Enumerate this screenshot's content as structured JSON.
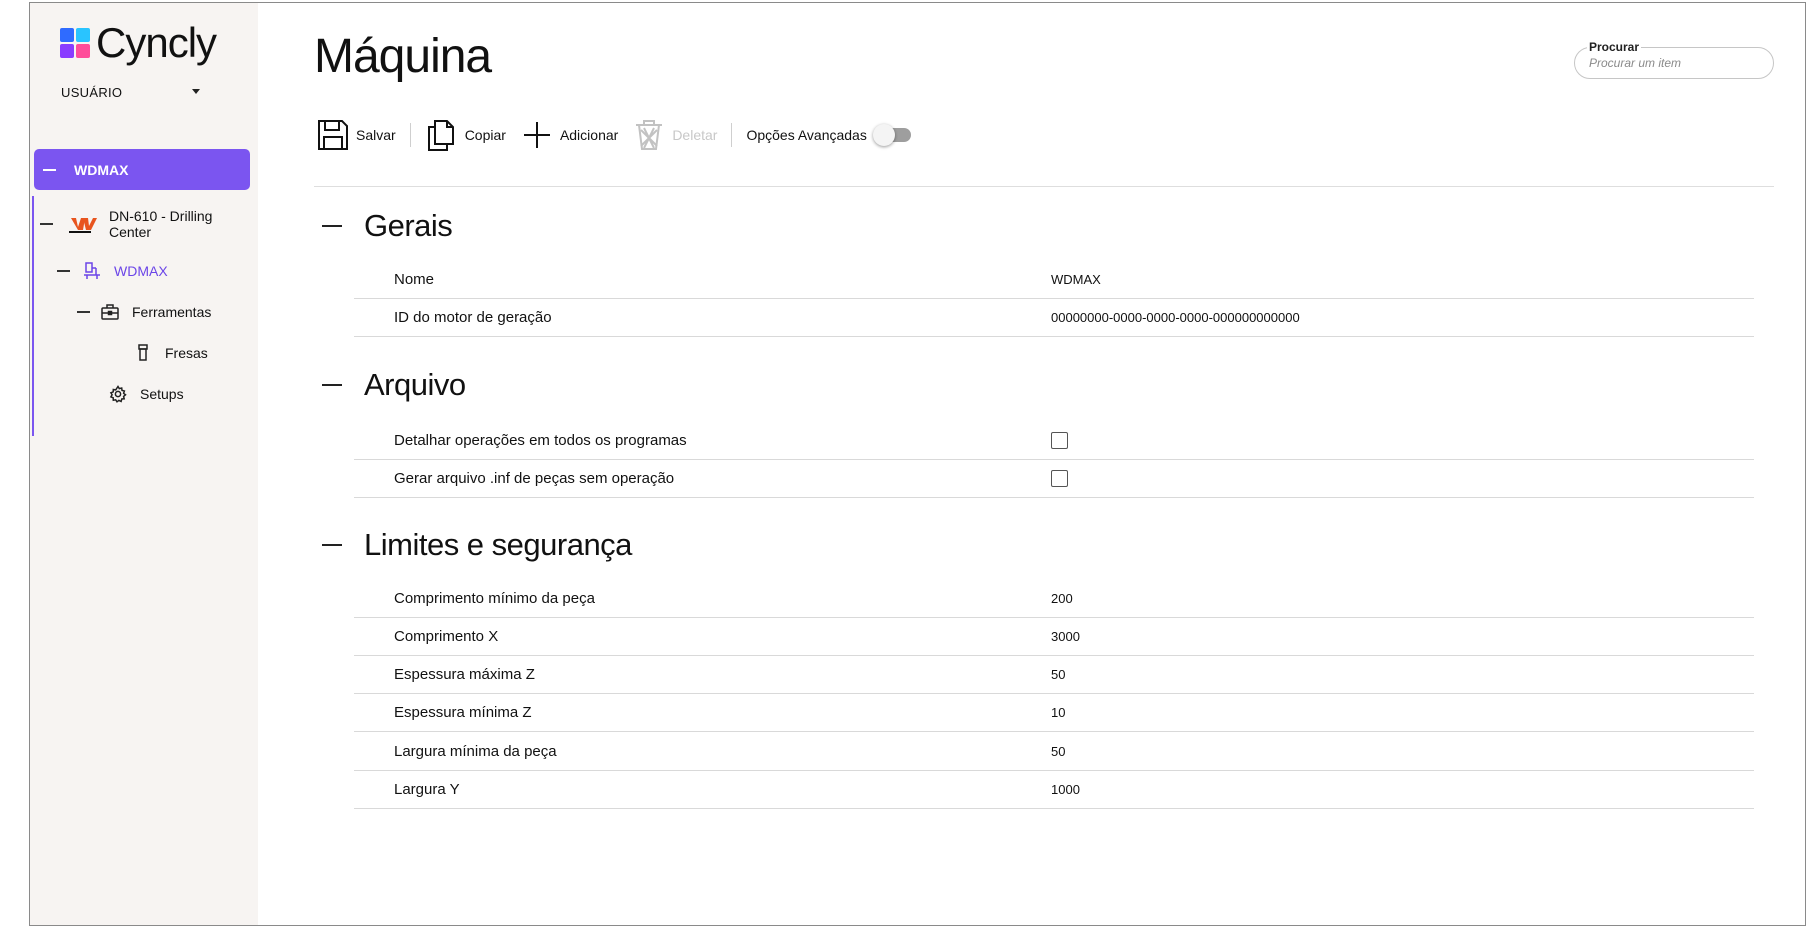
{
  "app": {
    "name": "Cyncly"
  },
  "user": {
    "label": "USUÁRIO"
  },
  "tree": {
    "root": {
      "label": "WDMAX"
    },
    "machine": {
      "label": "DN-610 - Drilling Center"
    },
    "model": {
      "label": "WDMAX"
    },
    "tools": {
      "label": "Ferramentas"
    },
    "mills": {
      "label": "Fresas"
    },
    "setups": {
      "label": "Setups"
    }
  },
  "page": {
    "title": "Máquina"
  },
  "search": {
    "label": "Procurar",
    "placeholder": "Procurar um item"
  },
  "toolbar": {
    "save": "Salvar",
    "copy": "Copiar",
    "add": "Adicionar",
    "delete": "Deletar",
    "advanced": "Opções Avançadas",
    "advanced_on": false
  },
  "sections": {
    "gerais": {
      "title": "Gerais",
      "rows": [
        {
          "label": "Nome",
          "value": "WDMAX"
        },
        {
          "label": "ID do motor de geração",
          "value": "00000000-0000-0000-0000-000000000000"
        }
      ]
    },
    "arquivo": {
      "title": "Arquivo",
      "rows": [
        {
          "label": "Detalhar operações em todos os programas",
          "checked": false
        },
        {
          "label": "Gerar arquivo .inf de peças sem operação",
          "checked": false
        }
      ]
    },
    "limites": {
      "title": "Limites e segurança",
      "rows": [
        {
          "label": "Comprimento mínimo da peça",
          "value": "200"
        },
        {
          "label": "Comprimento X",
          "value": "3000"
        },
        {
          "label": "Espessura máxima Z",
          "value": "50"
        },
        {
          "label": "Espessura mínima Z",
          "value": "10"
        },
        {
          "label": "Largura mínima da peça",
          "value": "50"
        },
        {
          "label": "Largura Y",
          "value": "1000"
        }
      ]
    }
  },
  "colors": {
    "accent": "#7b55f0",
    "sidebar_bg": "#f7f4f2",
    "machine_logo": "#e8541e"
  }
}
